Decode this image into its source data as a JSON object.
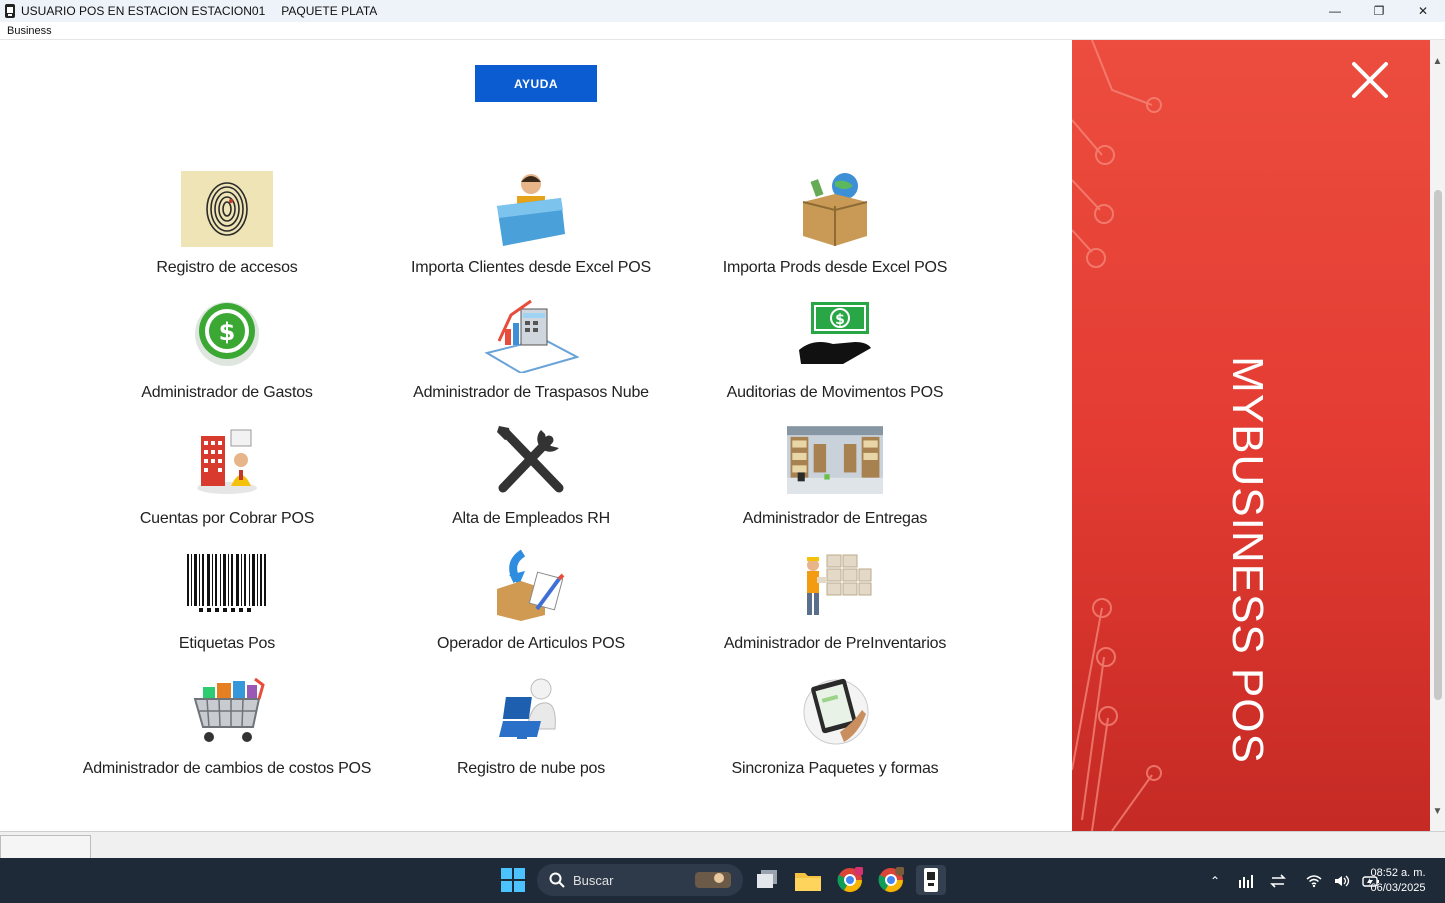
{
  "window": {
    "title": "USUARIO POS EN ESTACION ESTACION01",
    "package": "PAQUETE PLATA",
    "minimize": "—",
    "restore": "❐",
    "close": "✕"
  },
  "menu": {
    "item": "Business"
  },
  "help_button": "AYUDA",
  "tiles": [
    {
      "label": "Registro de accesos",
      "icon": "fingerprint-icon"
    },
    {
      "label": "Importa Clientes desde Excel POS",
      "icon": "folder-user-icon"
    },
    {
      "label": "Importa Prods desde Excel POS",
      "icon": "box-globe-icon"
    },
    {
      "label": "Administrador de Gastos",
      "icon": "dollar-refresh-icon"
    },
    {
      "label": "Administrador de Traspasos Nube",
      "icon": "calculator-chart-icon"
    },
    {
      "label": "Auditorias de Movimentos POS",
      "icon": "cash-hand-icon"
    },
    {
      "label": "Cuentas por Cobrar POS",
      "icon": "building-person-icon"
    },
    {
      "label": "Alta de Empleados RH",
      "icon": "tools-icon"
    },
    {
      "label": "Administrador de Entregas",
      "icon": "warehouse-icon"
    },
    {
      "label": "Etiquetas Pos",
      "icon": "barcode-icon"
    },
    {
      "label": "Operador de Articulos POS",
      "icon": "box-edit-icon"
    },
    {
      "label": "Administrador de PreInventarios",
      "icon": "worker-boxes-icon"
    },
    {
      "label": "Administrador de cambios de costos POS",
      "icon": "shopping-cart-icon"
    },
    {
      "label": "Registro de nube pos",
      "icon": "laptop-user-icon"
    },
    {
      "label": "Sincroniza Paquetes y formas",
      "icon": "tablet-hand-icon"
    }
  ],
  "brand": "MYBUSINESS POS",
  "colors": {
    "accent": "#0b5bd1",
    "panel_red": "#e43c33",
    "taskbar": "#1f2a38"
  },
  "taskbar": {
    "search_placeholder": "Buscar",
    "time": "08:52 a. m.",
    "date": "06/03/2025"
  }
}
